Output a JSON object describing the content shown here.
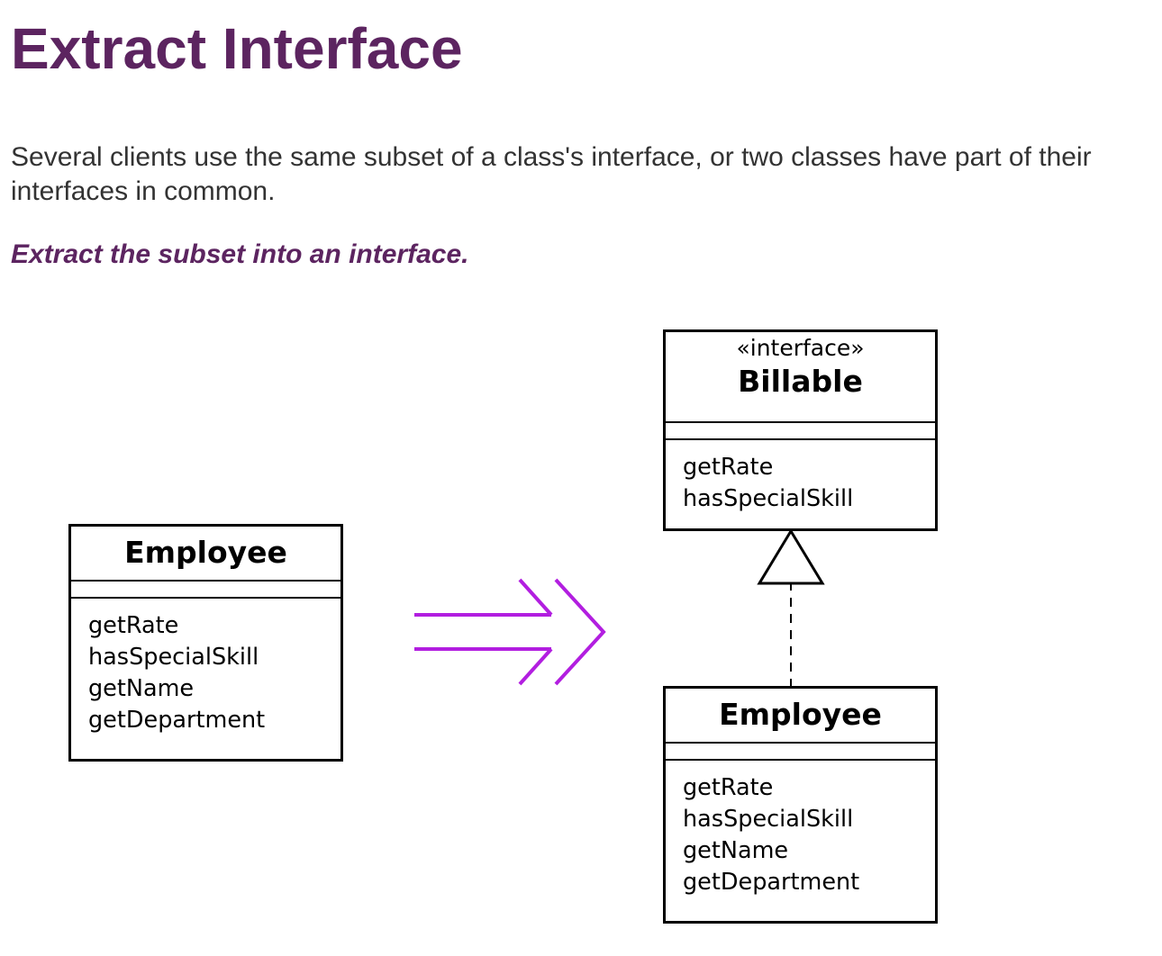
{
  "title": "Extract Interface",
  "problem": "Several clients use the same subset of a class's interface, or two classes have part of their interfaces in common.",
  "solution": "Extract the subset into an interface.",
  "colors": {
    "title": "#5c2460",
    "body_text": "#333333",
    "arrow": "#b21ee0",
    "uml_stroke": "#000000"
  },
  "diagram": {
    "before": {
      "class_name": "Employee",
      "methods": [
        "getRate",
        "hasSpecialSkill",
        "getName",
        "getDepartment"
      ]
    },
    "transform_arrow_icon": "double-arrow-right-icon",
    "after": {
      "interface": {
        "stereotype": "«interface»",
        "name": "Billable",
        "methods": [
          "getRate",
          "hasSpecialSkill"
        ]
      },
      "realization_icon": "hollow-triangle-arrowhead-icon",
      "class": {
        "class_name": "Employee",
        "methods": [
          "getRate",
          "hasSpecialSkill",
          "getName",
          "getDepartment"
        ]
      }
    }
  }
}
